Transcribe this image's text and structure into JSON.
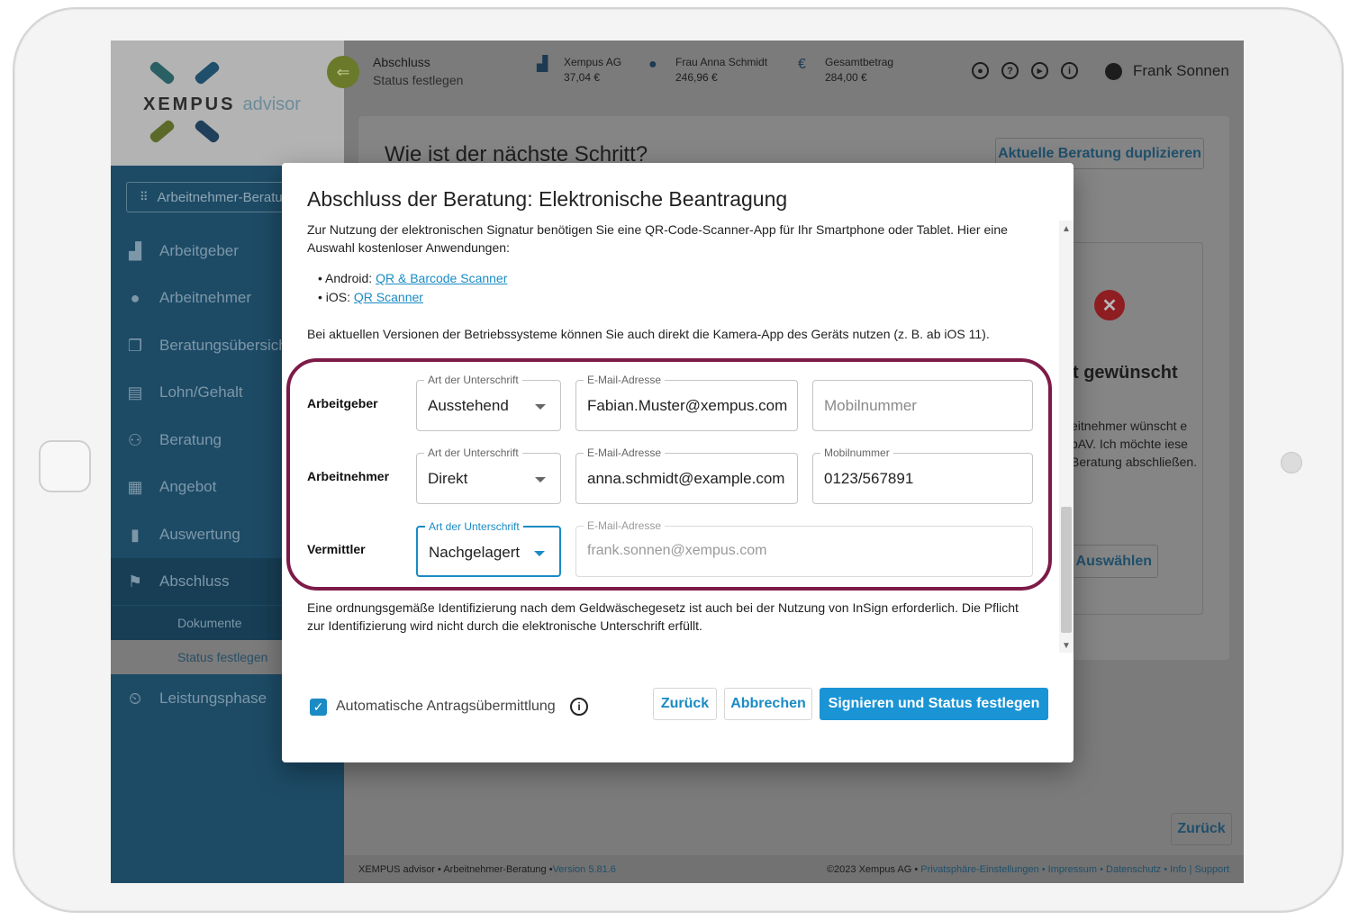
{
  "app": {
    "logo_brand": "XEMPUS",
    "logo_suffix": "advisor"
  },
  "header": {
    "title": "Abschluss",
    "subtitle": "Status festlegen",
    "employer": {
      "name": "Xempus AG",
      "amount": "37,04 €"
    },
    "employee": {
      "name": "Frau Anna Schmidt",
      "amount": "246,96 €"
    },
    "total": {
      "name": "Gesamtbetrag",
      "amount": "284,00 €"
    },
    "user": "Frank Sonnen"
  },
  "sidebar": {
    "select_label": "Arbeitnehmer-Beratung",
    "items": [
      {
        "label": "Arbeitgeber",
        "icon": "factory-icon"
      },
      {
        "label": "Arbeitnehmer",
        "icon": "person-icon"
      },
      {
        "label": "Beratungsübersicht",
        "icon": "copy-icon"
      },
      {
        "label": "Lohn/Gehalt",
        "icon": "document-icon"
      },
      {
        "label": "Beratung",
        "icon": "people-icon"
      },
      {
        "label": "Angebot",
        "icon": "calculator-icon"
      },
      {
        "label": "Auswertung",
        "icon": "bar-chart-icon"
      },
      {
        "label": "Abschluss",
        "icon": "flag-icon"
      },
      {
        "label": "Leistungsphase",
        "icon": "timer-icon"
      }
    ],
    "sub_items": [
      "Dokumente",
      "Status festlegen"
    ]
  },
  "main": {
    "title": "Wie ist der nächste Schritt?",
    "duplicate_button": "Aktuelle Beratung duplizieren",
    "side_heading": "t gewünscht",
    "side_text": "eitnehmer wünscht e bAV. Ich möchte iese Beratung abschließen.",
    "side_button": "Auswählen",
    "back_button": "Zurück"
  },
  "footer": {
    "left": "XEMPUS advisor • Arbeitnehmer-Beratung • ",
    "version": "Version 5.81.6",
    "copyright": "©2023 Xempus AG • ",
    "links": "Privatsphäre-Einstellungen • Impressum • Datenschutz • Info | Support"
  },
  "modal": {
    "title": "Abschluss der Beratung: Elektronische Beantragung",
    "intro": "Zur Nutzung der elektronischen Signatur benötigen Sie eine QR-Code-Scanner-App für Ihr Smartphone oder Tablet. Hier eine Auswahl kostenloser Anwendungen:",
    "android_label": "Android: ",
    "android_link": "QR & Barcode Scanner",
    "ios_label": "iOS: ",
    "ios_link": "QR Scanner",
    "camera_note": "Bei aktuellen Versionen der Betriebssysteme können Sie auch direkt die Kamera-App des Geräts nutzen (z. B. ab iOS 11).",
    "rows": [
      {
        "label": "Arbeitgeber",
        "sign_label": "Art der Unterschrift",
        "sign_value": "Ausstehend",
        "email_label": "E-Mail-Adresse",
        "email_value": "Fabian.Muster@xempus.com",
        "mobile_placeholder": "Mobilnummer"
      },
      {
        "label": "Arbeitnehmer",
        "sign_label": "Art der Unterschrift",
        "sign_value": "Direkt",
        "email_label": "E-Mail-Adresse",
        "email_value": "anna.schmidt@example.com",
        "mobile_label": "Mobilnummer",
        "mobile_value": "0123/567891"
      },
      {
        "label": "Vermittler",
        "sign_label": "Art der Unterschrift",
        "sign_value": "Nachgelagert",
        "email_label": "E-Mail-Adresse",
        "email_value": "frank.sonnen@xempus.com"
      }
    ],
    "gwg_note": "Eine ordnungsgemäße Identifizierung nach dem Geldwäschegesetz ist auch bei der Nutzung von InSign erforderlich. Die Pflicht zur Identifizierung wird nicht durch die elektronische Unterschrift erfüllt.",
    "auto_submit_label": "Automatische Antragsübermittlung",
    "auto_submit_checked": true,
    "back_button": "Zurück",
    "cancel_button": "Abbrechen",
    "submit_button": "Signieren und Status festlegen"
  },
  "colors": {
    "accent": "#1a94d4",
    "highlight": "#7d1b48",
    "sidebar": "#1d4b66"
  }
}
